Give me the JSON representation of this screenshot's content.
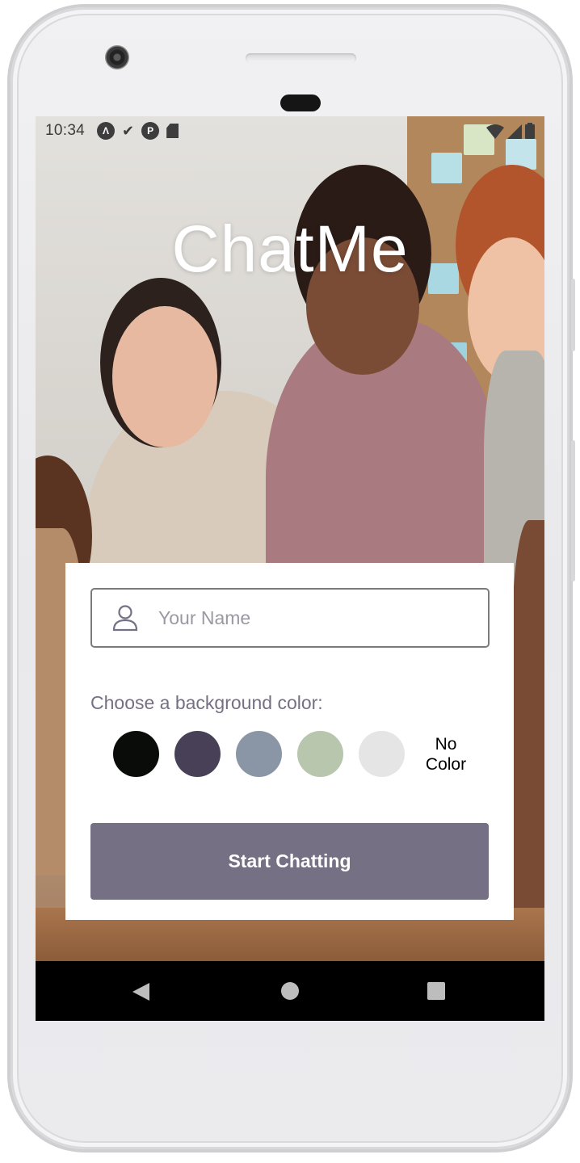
{
  "status_bar": {
    "time": "10:34",
    "left_icons": [
      "react-native-icon",
      "download-done-icon",
      "app-icon",
      "sd-card-icon"
    ],
    "right_icons": [
      "wifi-icon",
      "cellular-signal-icon",
      "battery-icon"
    ]
  },
  "app": {
    "title": "ChatMe"
  },
  "form": {
    "name_placeholder": "Your Name",
    "name_value": "",
    "color_prompt": "Choose a background color:",
    "swatches": [
      {
        "color": "#090C08"
      },
      {
        "color": "#474056"
      },
      {
        "color": "#8A95A5"
      },
      {
        "color": "#B9C6AE"
      },
      {
        "color": "#E5E5E5"
      }
    ],
    "no_color_line1": "No",
    "no_color_line2": "Color",
    "start_button": "Start Chatting"
  },
  "colors": {
    "accent": "#757083",
    "card_bg": "#FFFFFF",
    "title_text": "#FFFFFF"
  },
  "nav_bar": {
    "icons": [
      "back-icon",
      "home-icon",
      "recents-icon"
    ]
  }
}
